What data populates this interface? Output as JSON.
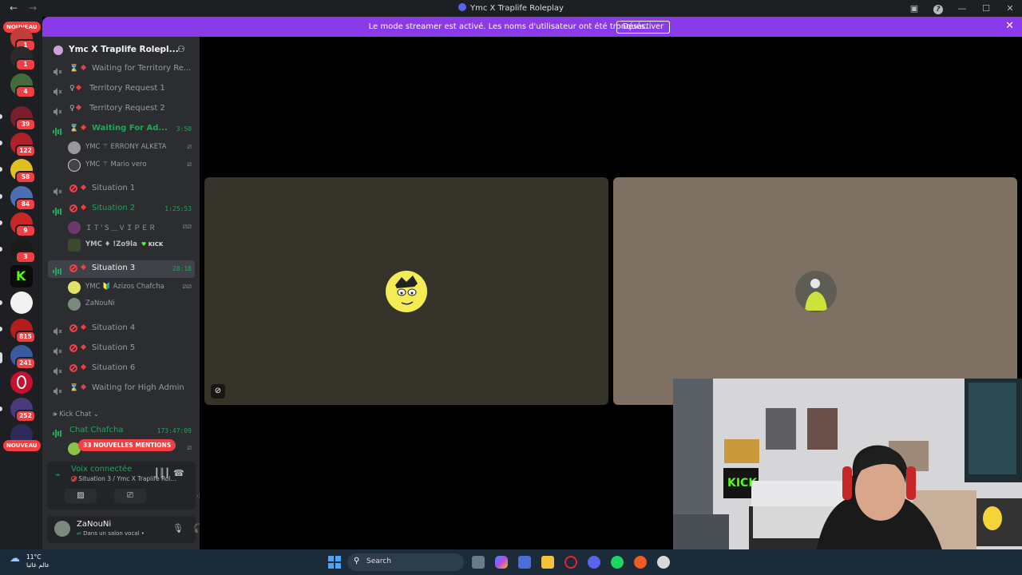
{
  "window": {
    "title": "Ymc X Traplife Roleplay"
  },
  "banner": {
    "text": "Le mode streamer est activé. Les noms d'utilisateur ont été tronqués.",
    "button": "Désactiver"
  },
  "rail": {
    "new_label": "NOUVEAU",
    "new_label_bottom": "NOUVEAU",
    "badges": [
      "1",
      "1",
      "4",
      "39",
      "122",
      "58",
      "84",
      "9",
      "3",
      "815",
      "241",
      "252"
    ]
  },
  "server": {
    "name": "Ymc X Traplife Rolepl..."
  },
  "channels": {
    "waiting_territory": "Waiting for Territory Re...",
    "territory1": "Territory Request 1",
    "territory2": "Territory Request 2",
    "waiting_admin": {
      "name": "Waiting For Ad...",
      "time": "3:50"
    },
    "situation1": "Situation 1",
    "situation2": {
      "name": "Situation 2",
      "time": "1:25:53"
    },
    "situation3": {
      "name": "Situation 3",
      "time": "28:18"
    },
    "situation4": "Situation 4",
    "situation5": "Situation 5",
    "situation6": "Situation 6",
    "waiting_high": "Waiting for High Admin",
    "category": "Kick Chat",
    "chat": {
      "name": "Chat Chafcha",
      "time": "173:47:09"
    }
  },
  "users": {
    "u1": "YMC ⚚ ERRONY ALKETA",
    "u2": "YMC ⚚ Mario vero",
    "u3": "ＩＴ'Ｓ＿ＶＩＰＥＲ",
    "u4": "YMC ♦ !Zo9la",
    "u4_tag": "KICK",
    "u5": "YMC 🔰 Azizos Chafcha",
    "u6": "ZaNouNi"
  },
  "mentions": "33 NOUVELLES MENTIONS",
  "voice": {
    "title": "Voix connectée",
    "sub": "Situation 3 / Ymc X Traplife Rol..."
  },
  "me": {
    "name": "ZaNouNi",
    "status": "Dans un salon vocal •"
  },
  "taskbar": {
    "temp": "11°C",
    "weather_txt": "عالم غائبا",
    "search": "Search"
  },
  "colors": {
    "accent": "#8a3ae8",
    "online": "#23a55a",
    "danger": "#f23f43"
  }
}
